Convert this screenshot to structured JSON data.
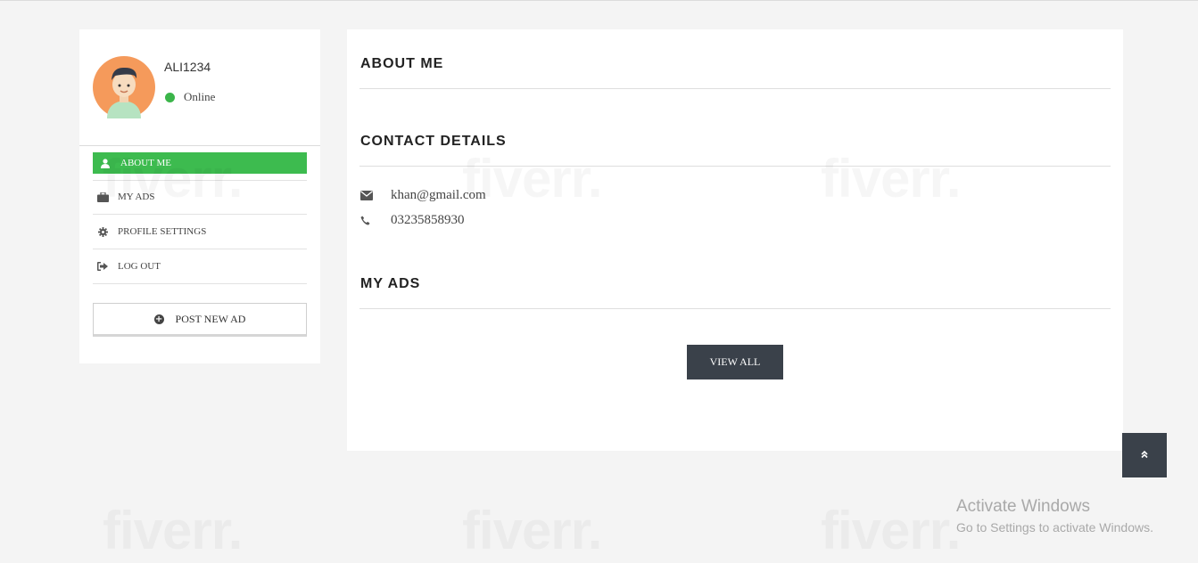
{
  "user": {
    "username": "ALI1234",
    "status": "Online"
  },
  "sidebar": {
    "items": [
      {
        "label": "ABOUT ME",
        "icon": "user-icon",
        "active": true
      },
      {
        "label": "MY ADS",
        "icon": "briefcase-icon",
        "active": false
      },
      {
        "label": "PROFILE SETTINGS",
        "icon": "gear-icon",
        "active": false
      },
      {
        "label": "LOG OUT",
        "icon": "sign-out-icon",
        "active": false
      }
    ],
    "post_button": "POST NEW AD"
  },
  "main": {
    "about_title": "ABOUT ME",
    "contact_title": "CONTACT DETAILS",
    "email": "khan@gmail.com",
    "phone": "03235858930",
    "ads_title": "MY ADS",
    "view_all": "VIEW ALL"
  },
  "os_notice": {
    "title": "Activate Windows",
    "subtitle": "Go to Settings to activate Windows."
  },
  "watermark": "fiverr.",
  "colors": {
    "accent_green": "#3dbb4f",
    "dark_button": "#3a414a",
    "online": "#3bb54a"
  }
}
